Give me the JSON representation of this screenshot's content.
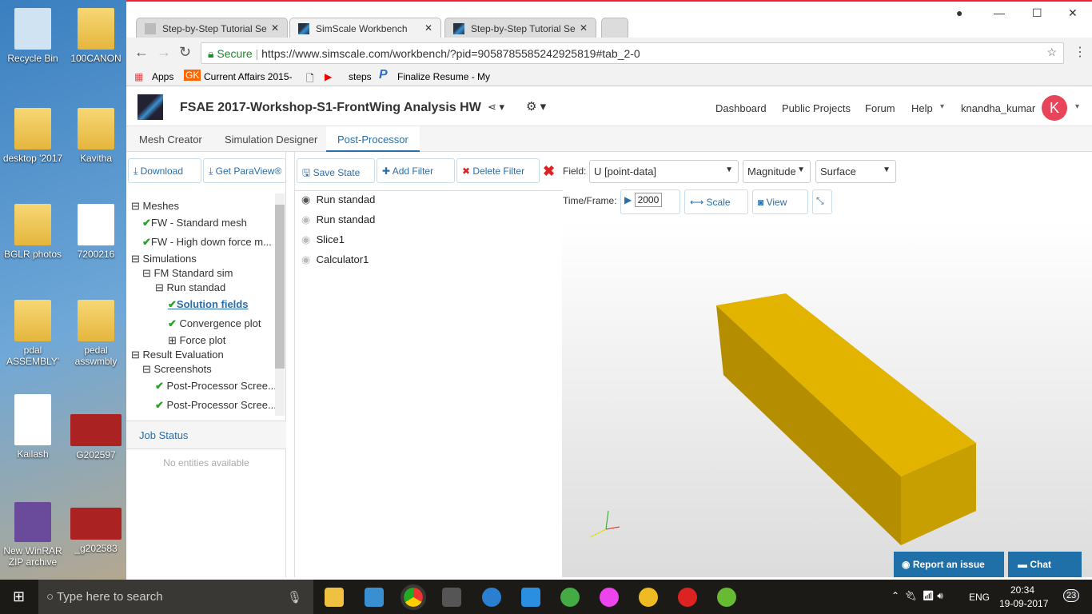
{
  "desktop": {
    "icons": [
      "Recycle Bin",
      "100CANON",
      "desktop '2017",
      "Kavitha",
      "BGLR photos",
      "7200216",
      "pdal ASSEMBLY'",
      "pedal asswmbly",
      "Kailash",
      "G202597",
      "New WinRAR ZIP archive",
      "_g202583"
    ]
  },
  "browser": {
    "tabs": [
      "Step-by-Step Tutorial Se",
      "SimScale Workbench",
      "Step-by-Step Tutorial Se"
    ],
    "secure": "Secure",
    "url": "https://www.simscale.com/workbench/?pid=9058785585242925819#tab_2-0",
    "bookmarks": [
      "Apps",
      "Current Affairs 2015-",
      "steps",
      "Finalize Resume - My"
    ]
  },
  "app": {
    "title": "FSAE 2017-Workshop-S1-FrontWing Analysis HW",
    "nav": [
      "Dashboard",
      "Public Projects",
      "Forum",
      "Help"
    ],
    "user": "knandha_kumar",
    "avatar": "K",
    "subtabs": [
      "Mesh Creator",
      "Simulation Designer",
      "Post-Processor"
    ]
  },
  "left": {
    "download": "Download",
    "paraview": "Get ParaView®",
    "tree": [
      "Meshes",
      "FW - Standard mesh",
      "FW - High down force m...",
      "Simulations",
      "FM Standard sim",
      "Run standad",
      "Solution fields",
      "Convergence plot",
      "Force plot",
      "Result Evaluation",
      "Screenshots",
      "Post-Processor Scree...",
      "Post-Processor Scree..."
    ],
    "job_status": "Job Status",
    "no_entities": "No entities available"
  },
  "mid": {
    "save": "Save State",
    "add": "Add Filter",
    "delete": "Delete Filter",
    "filters": [
      "Run standad",
      "Run standad",
      "Slice1",
      "Calculator1"
    ]
  },
  "toolbar": {
    "field_label": "Field:",
    "field": "U [point-data]",
    "component": "Magnitude",
    "repr": "Surface",
    "time_label": "Time/Frame:",
    "frame": "2000",
    "scale": "Scale",
    "view": "View"
  },
  "bottom": {
    "report": "Report an issue",
    "chat": "Chat"
  },
  "taskbar": {
    "search": "Type here to search",
    "lang": "ENG",
    "time": "20:34",
    "date": "19-09-2017",
    "notif": "23"
  },
  "colors": {
    "accent": "#2a6ea8",
    "box": "#e2b400",
    "avatar": "#e8445a"
  }
}
